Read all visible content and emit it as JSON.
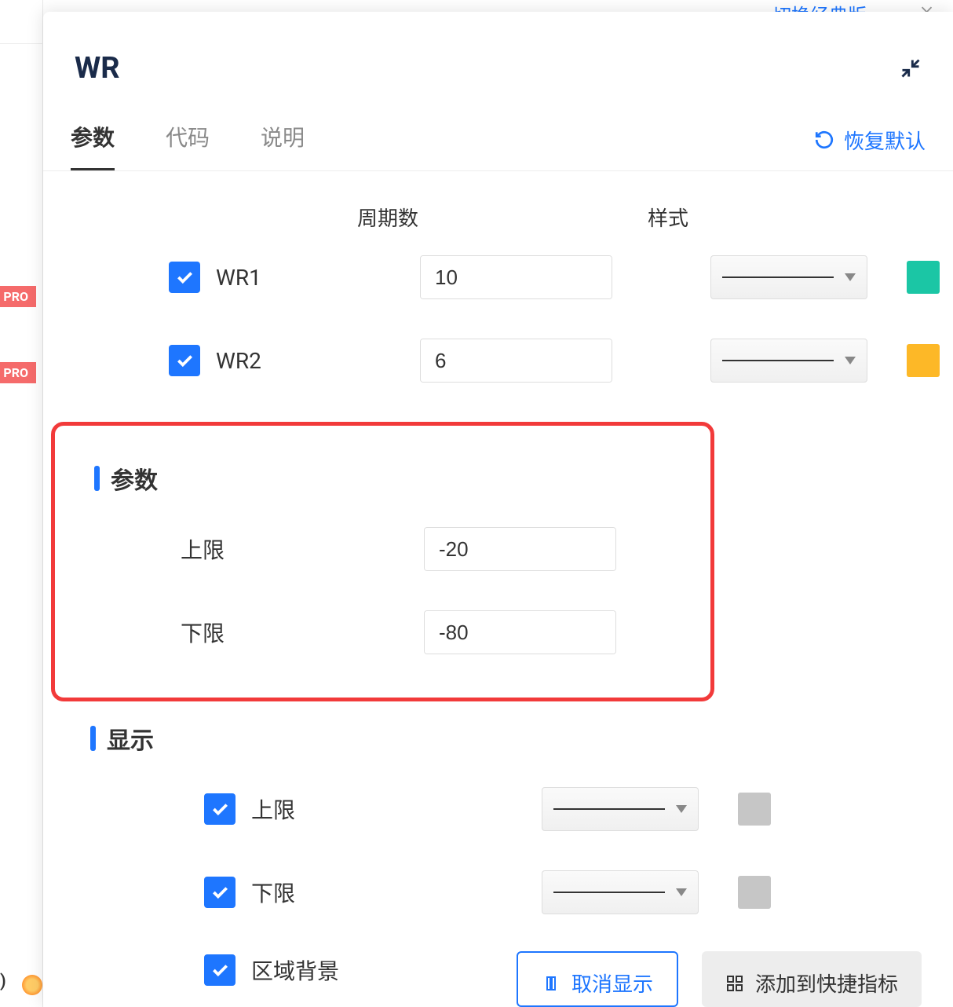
{
  "top_link": "切换经典版",
  "close_label": "×",
  "pro_badge": "PRO",
  "bottom_left_text": ")",
  "modal": {
    "title": "WR",
    "tabs": [
      "参数",
      "代码",
      "说明"
    ],
    "reset_label": "恢复默认"
  },
  "columns": {
    "period": "周期数",
    "style": "样式"
  },
  "rows": {
    "wr1": {
      "label": "WR1",
      "period": "10",
      "color": "#1bc6a5"
    },
    "wr2": {
      "label": "WR2",
      "period": "6",
      "color": "#fdb827"
    }
  },
  "sections": {
    "params": "参数",
    "display": "显示"
  },
  "params": {
    "upper": {
      "label": "上限",
      "value": "-20"
    },
    "lower": {
      "label": "下限",
      "value": "-80"
    }
  },
  "display": {
    "upper": "上限",
    "lower": "下限",
    "area_bg": "区域背景"
  },
  "footer": {
    "cancel": "取消显示",
    "add": "添加到快捷指标"
  }
}
